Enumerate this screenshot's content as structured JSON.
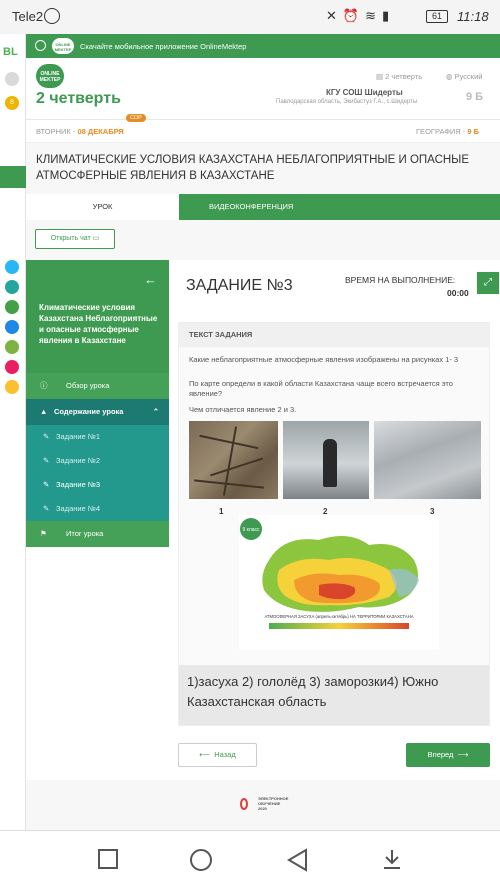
{
  "status_bar": {
    "carrier": "Tele2",
    "battery": "61",
    "time": "11:18"
  },
  "rail": {
    "logo": "BL",
    "badge": "8"
  },
  "banner": {
    "logo": "ONLINE MEKTEP",
    "text": "Скачайте мобильное приложение OnlineMektep"
  },
  "header": {
    "logo": "ONLINE MEKTEP",
    "quarter_small": "2 четверть",
    "language": "Русский",
    "quarter_big": "2 четверть",
    "school": "КГУ СОШ Шидерты",
    "region": "Павлодарская область, Экибастуз Г.А., с.Шидерты",
    "grade": "9 Б"
  },
  "date_row": {
    "day": "ВТОРНИК - ",
    "date": "08 ДЕКАБРЯ",
    "sor_badge": "СОР",
    "subject_label": "ГЕОГРАФИЯ - ",
    "subject_grade": "9 Б"
  },
  "lesson_title": "КЛИМАТИЧЕСКИЕ УСЛОВИЯ КАЗАХСТАНА НЕБЛАГОПРИЯТНЫЕ И ОПАСНЫЕ АТМОСФЕРНЫЕ ЯВЛЕНИЯ В КАЗАХСТАНЕ",
  "tabs": {
    "lesson": "УРОК",
    "video": "ВИДЕОКОНФЕРЕНЦИЯ"
  },
  "chat_button": "Открыть чат",
  "sidebar": {
    "title": "Климатические условия Казахстана Неблагоприятные и опасные атмосферные явления в Казахстане",
    "overview": "Обзор урока",
    "content": "Содержание урока",
    "tasks": [
      "Задание №1",
      "Задание №2",
      "Задание №3",
      "Задание №4"
    ],
    "summary": "Итог урока"
  },
  "main": {
    "task_title": "ЗАДАНИЕ №3",
    "timer_label": "ВРЕМЯ НА ВЫПОЛНЕНИЕ:",
    "timer_value": "00:00",
    "task_header": "ТЕКСТ ЗАДАНИЯ",
    "q1": "Какие неблагоприятные атмосферные явления изображены на рисунках 1- 3",
    "q2": "По карте определи в какой области Казахстана чаще всего встречается это явление?",
    "q3": "Чем отличается явление 2 и 3.",
    "photo_numbers": [
      "1",
      "2",
      "3"
    ],
    "map_badge": "9 класс",
    "map_title": "АТМОСФЕРНАЯ ЗАСУХА (апрель-октябрь) НА ТЕРРИТОРИИ КАЗАХСТАНА",
    "answer": "1)засуха 2) гололёд 3) заморозки4) Южно Казахстанская область",
    "back_button": "Назад",
    "next_button": "Вперед"
  },
  "footer": {
    "text_lines": [
      "ЭЛЕКТРОННОЕ",
      "ОБУЧЕНИЕ",
      "2020"
    ]
  },
  "colors": {
    "accent": "#3d9a50",
    "teal": "#1d7a72",
    "orange": "#e58d24"
  }
}
